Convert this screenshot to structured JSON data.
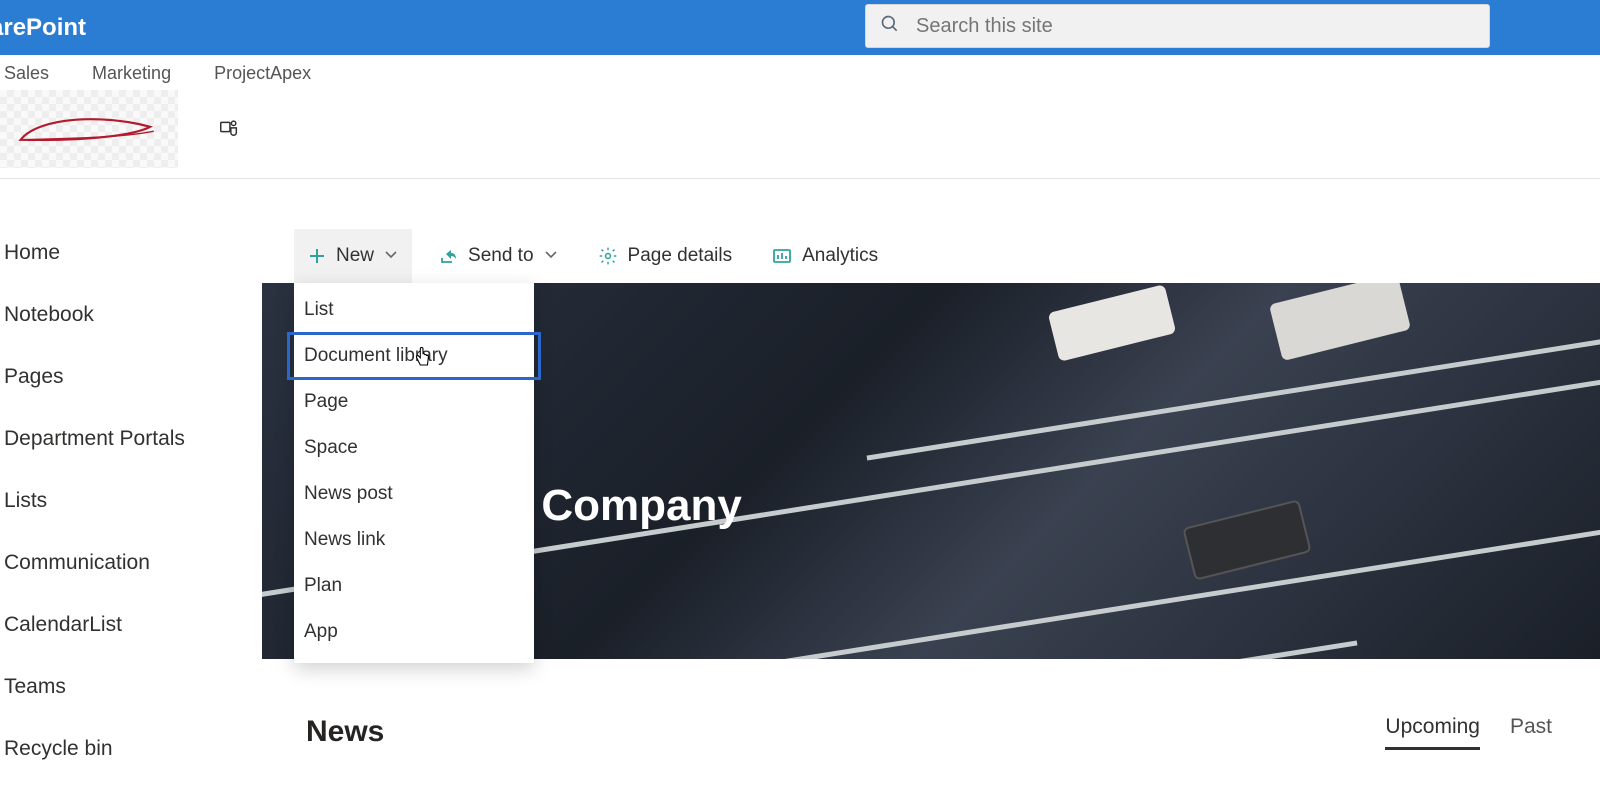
{
  "suite": {
    "title": "arePoint"
  },
  "search": {
    "placeholder": "Search this site"
  },
  "topNav": {
    "items": [
      "Sales",
      "Marketing",
      "ProjectApex"
    ]
  },
  "leftNav": {
    "items": [
      "Home",
      "Notebook",
      "Pages",
      "Department Portals",
      "Lists",
      "Communication",
      "CalendarList",
      "Teams",
      "Recycle bin"
    ]
  },
  "cmdBar": {
    "new": "New",
    "sendTo": "Send to",
    "pageDetails": "Page details",
    "analytics": "Analytics"
  },
  "newMenu": {
    "items": [
      "List",
      "Document library",
      "Page",
      "Space",
      "News post",
      "News link",
      "Plan",
      "App"
    ],
    "highlighted": 1
  },
  "hero": {
    "title": "r Company"
  },
  "news": {
    "heading": "News",
    "tabs": [
      "Upcoming",
      "Past"
    ],
    "activeTab": 0
  }
}
